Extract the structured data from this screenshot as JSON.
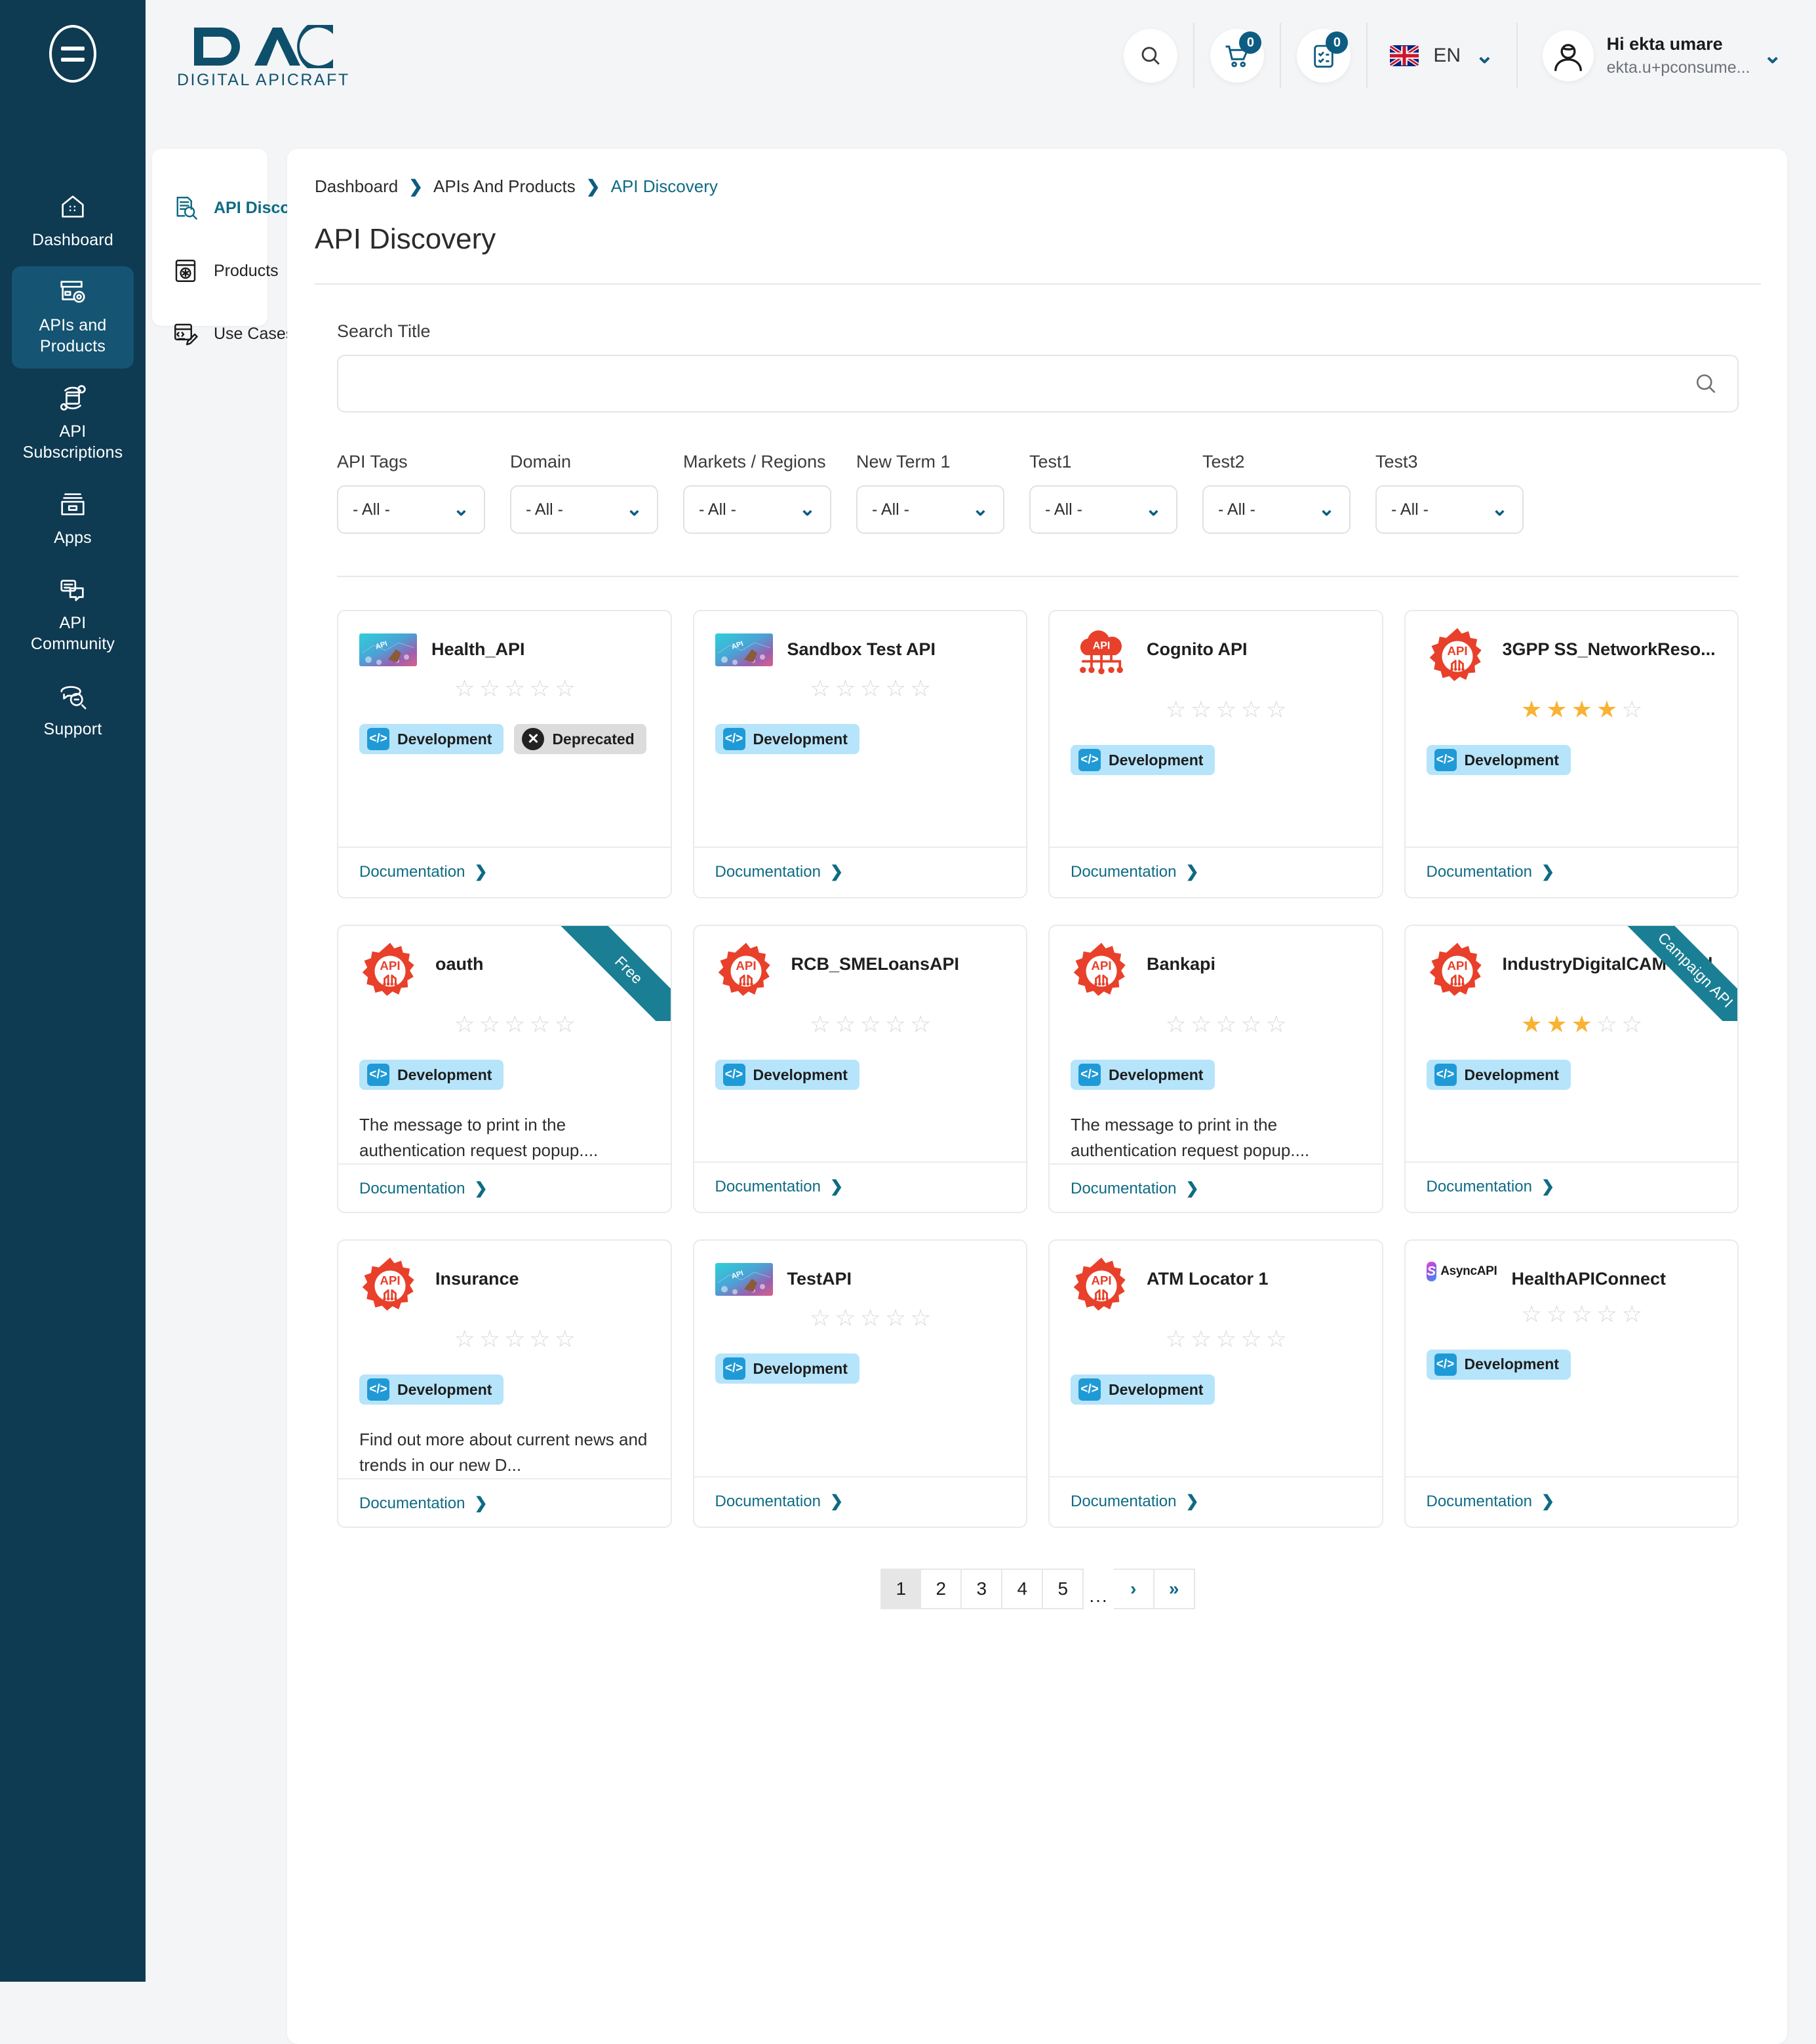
{
  "brand": {
    "name": "DAC",
    "tagline": "DIGITAL APICRAFT"
  },
  "rail": {
    "menu_icon": "hamburger-icon",
    "items": [
      {
        "label": "Dashboard",
        "icon": "home-icon",
        "active": false
      },
      {
        "label": "APIs and Products",
        "icon": "box-gear-icon",
        "active": true
      },
      {
        "label": "API Subscriptions",
        "icon": "subscription-icon",
        "active": false
      },
      {
        "label": "Apps",
        "icon": "apps-icon",
        "active": false
      },
      {
        "label": "API Community",
        "icon": "chat-icon",
        "active": false
      },
      {
        "label": "Support",
        "icon": "support-icon",
        "active": false
      }
    ]
  },
  "header": {
    "search_icon": "search-icon",
    "cart": {
      "icon": "cart-icon",
      "count": "0"
    },
    "tasks": {
      "icon": "clipboard-check-icon",
      "count": "0"
    },
    "language": {
      "code": "EN",
      "flag": "uk-flag-icon"
    },
    "user": {
      "greeting": "Hi ekta umare",
      "email": "ekta.u+pconsume...",
      "avatar": "user-avatar-icon"
    }
  },
  "subnav": {
    "items": [
      {
        "label": "API Discovery",
        "icon": "discovery-icon",
        "active": true
      },
      {
        "label": "Products",
        "icon": "product-gear-icon",
        "active": false
      },
      {
        "label": "Use Cases",
        "icon": "use-case-icon",
        "active": false
      }
    ]
  },
  "breadcrumb": {
    "items": [
      "Dashboard",
      "APIs And Products",
      "API Discovery"
    ]
  },
  "page": {
    "title": "API Discovery"
  },
  "search": {
    "label": "Search Title",
    "value": "",
    "placeholder": "",
    "icon": "search-icon"
  },
  "filters": [
    {
      "label": "API Tags",
      "value": "- All -"
    },
    {
      "label": "Domain",
      "value": "- All -"
    },
    {
      "label": "Markets / Regions",
      "value": "- All -"
    },
    {
      "label": "New Term 1",
      "value": "- All -"
    },
    {
      "label": "Test1",
      "value": "- All -"
    },
    {
      "label": "Test2",
      "value": "- All -"
    },
    {
      "label": "Test3",
      "value": "- All -"
    }
  ],
  "cards": [
    {
      "title": "Health_API",
      "icon": "api-photo-thumbnail",
      "rating": 0,
      "tags": [
        {
          "label": "Development",
          "type": "dev"
        },
        {
          "label": "Deprecated",
          "type": "dep"
        }
      ],
      "description": "",
      "doc_label": "Documentation",
      "ribbon": ""
    },
    {
      "title": "Sandbox Test API",
      "icon": "api-photo-thumbnail",
      "rating": 0,
      "tags": [
        {
          "label": "Development",
          "type": "dev"
        }
      ],
      "description": "",
      "doc_label": "Documentation",
      "ribbon": ""
    },
    {
      "title": "Cognito API",
      "icon": "api-cloud-icon",
      "rating": 0,
      "tags": [
        {
          "label": "Development",
          "type": "dev"
        }
      ],
      "description": "",
      "doc_label": "Documentation",
      "ribbon": ""
    },
    {
      "title": "3GPP SS_NetworkReso...",
      "icon": "api-gear-icon",
      "rating": 4,
      "tags": [
        {
          "label": "Development",
          "type": "dev"
        }
      ],
      "description": "",
      "doc_label": "Documentation",
      "ribbon": ""
    },
    {
      "title": "oauth",
      "icon": "api-gear-icon",
      "rating": 0,
      "tags": [
        {
          "label": "Development",
          "type": "dev"
        }
      ],
      "description": "The message to print in the authentication request popup....",
      "doc_label": "Documentation",
      "ribbon": "Free"
    },
    {
      "title": "RCB_SMELoansAPI",
      "icon": "api-gear-icon",
      "rating": 0,
      "tags": [
        {
          "label": "Development",
          "type": "dev"
        }
      ],
      "description": "",
      "doc_label": "Documentation",
      "ribbon": ""
    },
    {
      "title": "Bankapi",
      "icon": "api-gear-icon",
      "rating": 0,
      "tags": [
        {
          "label": "Development",
          "type": "dev"
        }
      ],
      "description": "The message to print in the authentication request popup....",
      "doc_label": "Documentation",
      "ribbon": ""
    },
    {
      "title": "IndustryDigitalCAM-Gold",
      "icon": "api-gear-icon",
      "rating": 3,
      "tags": [
        {
          "label": "Development",
          "type": "dev"
        }
      ],
      "description": "",
      "doc_label": "Documentation",
      "ribbon": "Campaign API"
    },
    {
      "title": "Insurance",
      "icon": "api-gear-icon",
      "rating": 0,
      "tags": [
        {
          "label": "Development",
          "type": "dev"
        }
      ],
      "description": "Find out more about current news and trends in our new D...",
      "doc_label": "Documentation",
      "ribbon": ""
    },
    {
      "title": "TestAPI",
      "icon": "api-photo-thumbnail",
      "rating": 0,
      "tags": [
        {
          "label": "Development",
          "type": "dev"
        }
      ],
      "description": "",
      "doc_label": "Documentation",
      "ribbon": ""
    },
    {
      "title": "ATM Locator 1",
      "icon": "api-gear-icon",
      "rating": 0,
      "tags": [
        {
          "label": "Development",
          "type": "dev"
        }
      ],
      "description": "",
      "doc_label": "Documentation",
      "ribbon": ""
    },
    {
      "title": "HealthAPIConnect",
      "icon": "asyncapi-icon",
      "rating": 0,
      "tags": [
        {
          "label": "Development",
          "type": "dev"
        }
      ],
      "description": "",
      "doc_label": "Documentation",
      "ribbon": ""
    }
  ],
  "pagination": {
    "pages": [
      "1",
      "2",
      "3",
      "4",
      "5"
    ],
    "current": "1",
    "ellipsis": "...",
    "next": "›",
    "last": "»"
  },
  "colors": {
    "rail_bg": "#0e3a52",
    "rail_active": "#155472",
    "accent": "#0e6b84",
    "link": "#0e5c82",
    "tag_dev": "#b6e4fa",
    "tag_dep": "#dcdcdc",
    "ribbon": "#1a7f94",
    "star_on": "#f9b233",
    "gear_red": "#e8402a"
  }
}
